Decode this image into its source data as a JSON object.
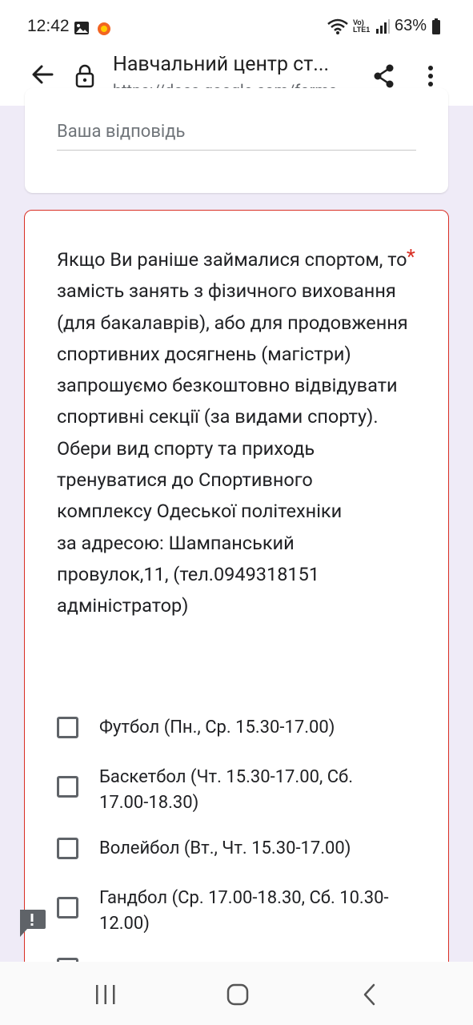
{
  "status": {
    "time": "12:42",
    "network": "Vo) LTE1",
    "battery": "63%"
  },
  "browser": {
    "title": "Навчальний центр ст...",
    "url": "https://docs.google.com/forms"
  },
  "form": {
    "answer_placeholder": "Ваша відповідь",
    "question": "Якщо Ви раніше займалися спортом, то замість занять з фізичного виховання (для бакалаврів), або для продовження спортивних досягнень (магістри) запрошуємо безкоштовно відвідувати спортивні секції (за видами спорту).\nОбери вид спорту та приходь тренуватися до Спортивного комплексу Одеської політехніки\n за адресою: Шампанський провулок,11, (тел.0949318151 адміністратор)",
    "required_mark": "*",
    "options": [
      {
        "label": "Футбол (Пн., Ср. 15.30-17.00)"
      },
      {
        "label": "Баскетбол (Чт. 15.30-17.00, Сб. 17.00-18.30)"
      },
      {
        "label": "Волейбол (Вт., Чт. 15.30-17.00)"
      },
      {
        "label": "Гандбол (Ср. 17.00-18.30, Сб. 10.30-12.00)"
      }
    ]
  },
  "colors": {
    "accent": "#d93025",
    "background": "#efebf7"
  }
}
